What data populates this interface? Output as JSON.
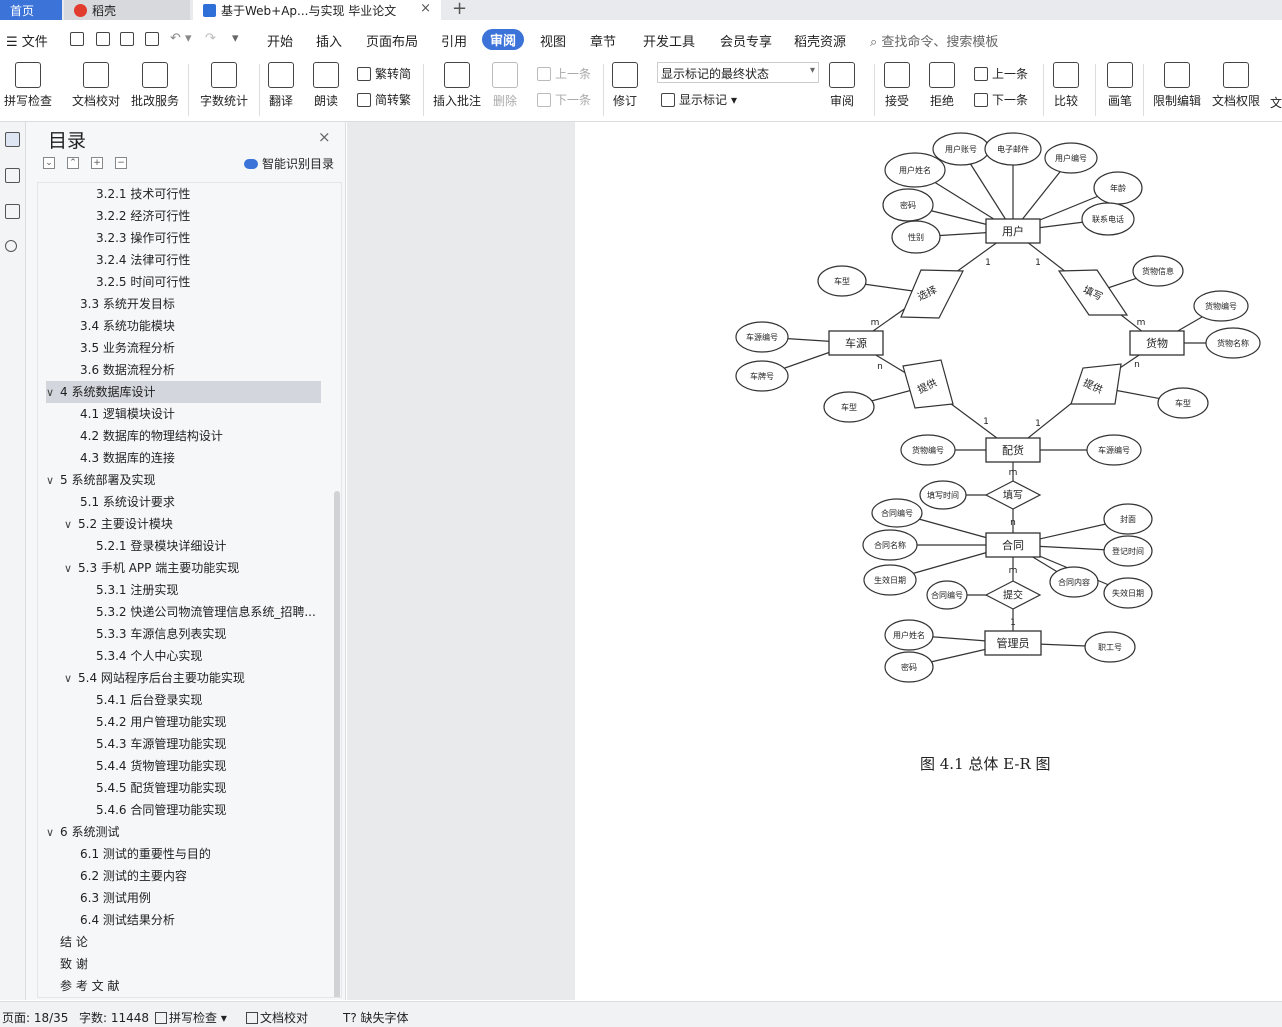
{
  "tabs": {
    "home": "首页",
    "daoke": "稻壳",
    "doc": "基于Web+Ap...与实现 毕业论文",
    "close": "×",
    "add": "+"
  },
  "menu": {
    "file": "☰ 文件",
    "items": [
      "开始",
      "插入",
      "页面布局",
      "引用",
      "审阅",
      "视图",
      "章节",
      "开发工具",
      "会员专享",
      "稻壳资源"
    ],
    "active": "审阅",
    "search": "查找命令、搜索模板"
  },
  "ribbon": {
    "spell_check": "拼写检查",
    "doc_proof": "文档校对",
    "correction": "批改服务",
    "word_count": "字数统计",
    "translate": "翻译",
    "read_aloud": "朗读",
    "to_traditional": "繁转简",
    "to_simplified": "简转繁",
    "insert_comment": "插入批注",
    "delete": "删除",
    "prev": "上一条",
    "next": "下一条",
    "track": "修订",
    "markup_mode": "显示标记的最终状态",
    "show_markup": "显示标记",
    "review": "审阅",
    "accept": "接受",
    "reject": "拒绝",
    "prev2": "上一条",
    "next2": "下一条",
    "compare": "比较",
    "pen": "画笔",
    "restrict_edit": "限制编辑",
    "doc_rights": "文档权限",
    "overflow": "文"
  },
  "toc": {
    "title": "目录",
    "close": "×",
    "smart": "智能识别目录",
    "items": [
      {
        "text": "3.2.1 技术可行性",
        "level": 3,
        "chev": ""
      },
      {
        "text": "3.2.2 经济可行性",
        "level": 3,
        "chev": ""
      },
      {
        "text": "3.2.3 操作可行性",
        "level": 3,
        "chev": ""
      },
      {
        "text": "3.2.4 法律可行性",
        "level": 3,
        "chev": ""
      },
      {
        "text": "3.2.5 时间可行性",
        "level": 3,
        "chev": ""
      },
      {
        "text": "3.3  系统开发目标",
        "level": 2,
        "chev": ""
      },
      {
        "text": "3.4  系统功能模块",
        "level": 2,
        "chev": ""
      },
      {
        "text": "3.5 业务流程分析",
        "level": 2,
        "chev": ""
      },
      {
        "text": "3.6 数据流程分析",
        "level": 2,
        "chev": ""
      },
      {
        "text": "4   系统数据库设计",
        "level": 1,
        "chev": "∨",
        "selected": true
      },
      {
        "text": "4.1 逻辑模块设计",
        "level": 2,
        "chev": ""
      },
      {
        "text": "4.2  数据库的物理结构设计",
        "level": 2,
        "chev": ""
      },
      {
        "text": "4.3  数据库的连接",
        "level": 2,
        "chev": ""
      },
      {
        "text": "5   系统部署及实现",
        "level": 1,
        "chev": "∨"
      },
      {
        "text": "5.1  系统设计要求",
        "level": 2,
        "chev": ""
      },
      {
        "text": "5.2  主要设计模块",
        "level": 2,
        "chev": "∨"
      },
      {
        "text": "5.2.1 登录模块详细设计",
        "level": 3,
        "chev": ""
      },
      {
        "text": "5.3 手机 APP 端主要功能实现",
        "level": 2,
        "chev": "∨"
      },
      {
        "text": "5.3.1  注册实现",
        "level": 3,
        "chev": ""
      },
      {
        "text": "5.3.2 快递公司物流管理信息系统_招聘...",
        "level": 3,
        "chev": ""
      },
      {
        "text": "5.3.3 车源信息列表实现",
        "level": 3,
        "chev": ""
      },
      {
        "text": "5.3.4 个人中心实现",
        "level": 3,
        "chev": ""
      },
      {
        "text": "5.4 网站程序后台主要功能实现",
        "level": 2,
        "chev": "∨"
      },
      {
        "text": "5.4.1  后台登录实现",
        "level": 3,
        "chev": ""
      },
      {
        "text": "5.4.2  用户管理功能实现",
        "level": 3,
        "chev": ""
      },
      {
        "text": "5.4.3  车源管理功能实现",
        "level": 3,
        "chev": ""
      },
      {
        "text": "5.4.4  货物管理功能实现",
        "level": 3,
        "chev": ""
      },
      {
        "text": "5.4.5  配货管理功能实现",
        "level": 3,
        "chev": ""
      },
      {
        "text": "5.4.6  合同管理功能实现",
        "level": 3,
        "chev": ""
      },
      {
        "text": "6   系统测试",
        "level": 1,
        "chev": "∨"
      },
      {
        "text": "6.1  测试的重要性与目的",
        "level": 2,
        "chev": ""
      },
      {
        "text": "6.2  测试的主要内容",
        "level": 2,
        "chev": ""
      },
      {
        "text": "6.3  测试用例",
        "level": 2,
        "chev": ""
      },
      {
        "text": "6.4  测试结果分析",
        "level": 2,
        "chev": ""
      },
      {
        "text": "结   论",
        "level": 1,
        "chev": ""
      },
      {
        "text": "致   谢",
        "level": 1,
        "chev": ""
      },
      {
        "text": "参 考 文 献",
        "level": 1,
        "chev": ""
      }
    ]
  },
  "er_diagram": {
    "entities": [
      {
        "id": "user",
        "label": "用户"
      },
      {
        "id": "car",
        "label": "车源"
      },
      {
        "id": "goods",
        "label": "货物"
      },
      {
        "id": "dispatch",
        "label": "配货"
      },
      {
        "id": "contract",
        "label": "合同"
      },
      {
        "id": "admin",
        "label": "管理员"
      }
    ],
    "relations": [
      {
        "id": "r_select",
        "label": "选择"
      },
      {
        "id": "r_fill1",
        "label": "填写"
      },
      {
        "id": "r_provide1",
        "label": "提供"
      },
      {
        "id": "r_provide2",
        "label": "提供"
      },
      {
        "id": "r_fill2",
        "label": "填写"
      },
      {
        "id": "r_submit",
        "label": "提交"
      }
    ],
    "attributes": [
      {
        "id": "a1",
        "label": "用户账号",
        "of": "user"
      },
      {
        "id": "a2",
        "label": "电子邮件",
        "of": "user"
      },
      {
        "id": "a3",
        "label": "用户姓名",
        "of": "user"
      },
      {
        "id": "a4",
        "label": "用户编号",
        "of": "user"
      },
      {
        "id": "a5",
        "label": "年龄",
        "of": "user"
      },
      {
        "id": "a6",
        "label": "密码",
        "of": "user"
      },
      {
        "id": "a7",
        "label": "联系电话",
        "of": "user"
      },
      {
        "id": "a8",
        "label": "性别",
        "of": "user"
      },
      {
        "id": "a9",
        "label": "车型",
        "of": "r_select"
      },
      {
        "id": "a10",
        "label": "货物信息",
        "of": "r_fill1"
      },
      {
        "id": "a11",
        "label": "货物编号",
        "of": "goods"
      },
      {
        "id": "a12",
        "label": "货物名称",
        "of": "goods"
      },
      {
        "id": "a13",
        "label": "车源编号",
        "of": "car"
      },
      {
        "id": "a14",
        "label": "车牌号",
        "of": "car"
      },
      {
        "id": "a15",
        "label": "车型",
        "of": "r_provide1"
      },
      {
        "id": "a16",
        "label": "车型",
        "of": "r_provide2"
      },
      {
        "id": "a17",
        "label": "货物编号",
        "of": "dispatch"
      },
      {
        "id": "a18",
        "label": "车源编号",
        "of": "dispatch"
      },
      {
        "id": "a19",
        "label": "填写时间",
        "of": "r_fill2"
      },
      {
        "id": "a20",
        "label": "合同编号",
        "of": "contract"
      },
      {
        "id": "a21",
        "label": "封面",
        "of": "contract"
      },
      {
        "id": "a22",
        "label": "合同名称",
        "of": "contract"
      },
      {
        "id": "a23",
        "label": "登记时间",
        "of": "contract"
      },
      {
        "id": "a24",
        "label": "生效日期",
        "of": "contract"
      },
      {
        "id": "a25",
        "label": "合同内容",
        "of": "contract"
      },
      {
        "id": "a26",
        "label": "失效日期",
        "of": "contract"
      },
      {
        "id": "a27",
        "label": "合同编号",
        "of": "r_submit"
      },
      {
        "id": "a28",
        "label": "用户姓名",
        "of": "admin"
      },
      {
        "id": "a29",
        "label": "职工号",
        "of": "admin"
      },
      {
        "id": "a30",
        "label": "密码",
        "of": "admin"
      }
    ],
    "cardinalities": [
      "1",
      "m",
      "1",
      "m",
      "n",
      "1",
      "n",
      "1",
      "m",
      "n",
      "m",
      "1"
    ]
  },
  "caption": "图 4.1  总体 E-R 图",
  "status": {
    "page": "页面: 18/35",
    "words": "字数: 11448",
    "spell": "拼写检查",
    "proof": "文档校对",
    "missing_font": "缺失字体"
  }
}
